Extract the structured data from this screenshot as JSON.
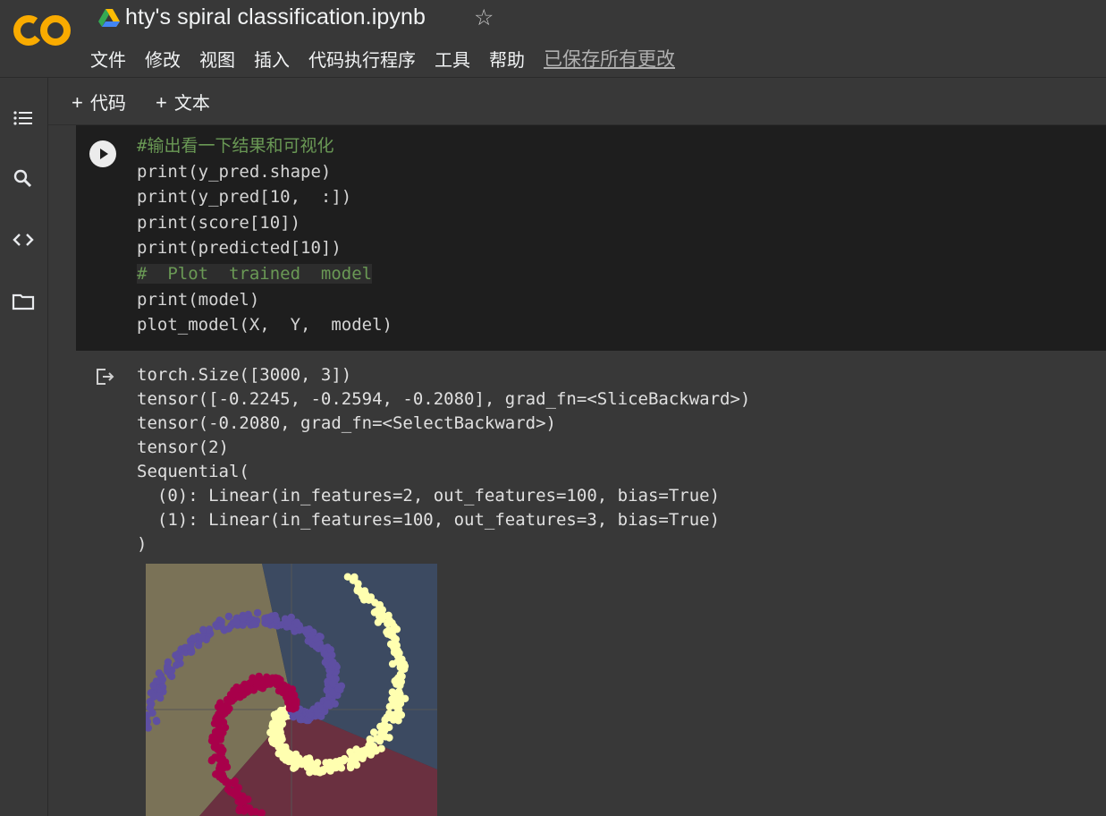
{
  "header": {
    "title": "hty's spiral classification.ipynb",
    "logo_icon": "colab-logo",
    "drive_icon": "google-drive-icon",
    "star_icon": "star-icon"
  },
  "menu": [
    "文件",
    "修改",
    "视图",
    "插入",
    "代码执行程序",
    "工具",
    "帮助"
  ],
  "save_status": "已保存所有更改",
  "sidebar_icons": [
    "table-of-contents-icon",
    "search-icon",
    "code-snippets-icon",
    "files-icon"
  ],
  "toolbar": {
    "add_code": "代码",
    "add_text": "文本"
  },
  "code_cell": {
    "lines": [
      "#输出看一下结果和可视化",
      "print(y_pred.shape)",
      "print(y_pred[10,  :])",
      "print(score[10])",
      "print(predicted[10])",
      "#  Plot  trained  model",
      "print(model)",
      "plot_model(X,  Y,  model)"
    ]
  },
  "output": {
    "lines": [
      "torch.Size([3000, 3])",
      "tensor([-0.2245, -0.2594, -0.2080], grad_fn=<SliceBackward>)",
      "tensor(-0.2080, grad_fn=<SelectBackward>)",
      "tensor(2)",
      "Sequential(",
      "  (0): Linear(in_features=2, out_features=100, bias=True)",
      "  (1): Linear(in_features=100, out_features=3, bias=True)",
      ")"
    ]
  },
  "plot": {
    "region_colors": [
      "#7a7257",
      "#3c4a61",
      "#6a3040"
    ],
    "class_colors": [
      "#ffffb0",
      "#5e4fa2",
      "#a8004a"
    ],
    "arms": 3
  }
}
